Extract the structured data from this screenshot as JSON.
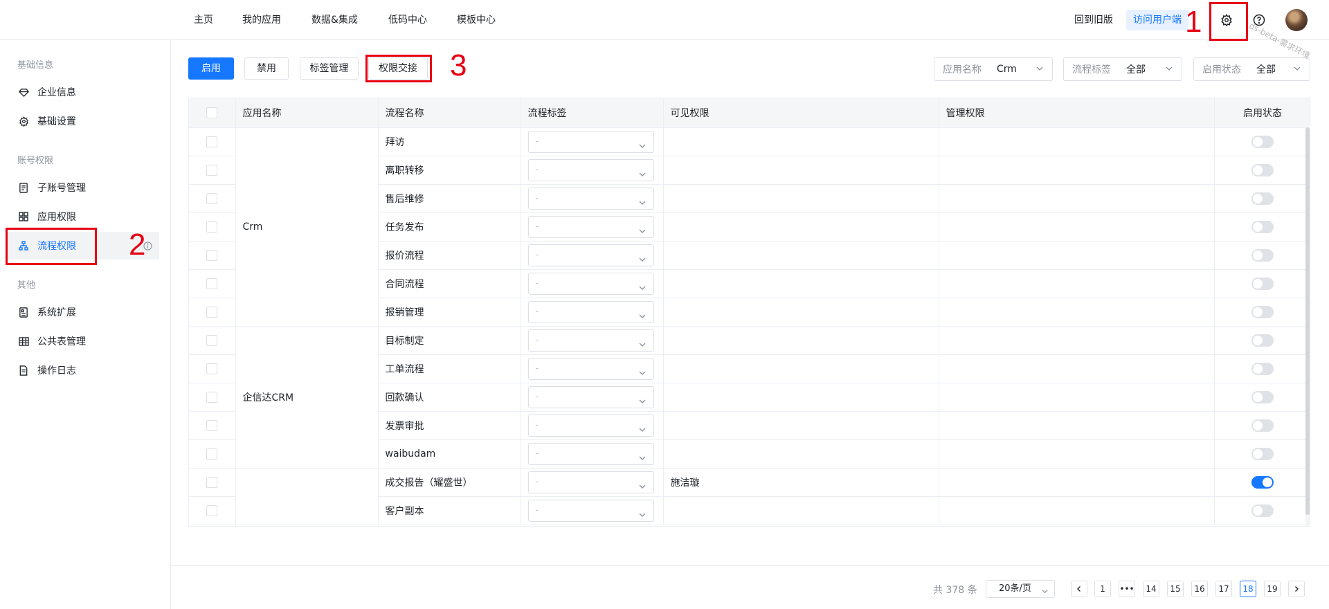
{
  "header": {
    "nav": [
      "主页",
      "我的应用",
      "数据&集成",
      "低码中心",
      "模板中心"
    ],
    "back_old": "回到旧版",
    "visit_user": "访问用户端",
    "watermark": "ds-beta-需求环境"
  },
  "annotations": [
    "1",
    "2",
    "3"
  ],
  "sidebar": {
    "groups": [
      {
        "title": "基础信息",
        "items": [
          {
            "label": "企业信息",
            "icon": "diamond-icon"
          },
          {
            "label": "基础设置",
            "icon": "gear-icon"
          }
        ]
      },
      {
        "title": "账号权限",
        "items": [
          {
            "label": "子账号管理",
            "icon": "document-icon"
          },
          {
            "label": "应用权限",
            "icon": "grid-icon"
          },
          {
            "label": "流程权限",
            "icon": "org-chart-icon",
            "active": true
          }
        ]
      },
      {
        "title": "其他",
        "items": [
          {
            "label": "系统扩展",
            "icon": "extension-icon"
          },
          {
            "label": "公共表管理",
            "icon": "table-icon"
          },
          {
            "label": "操作日志",
            "icon": "log-icon"
          }
        ]
      }
    ]
  },
  "toolbar": {
    "enable": "启用",
    "disable": "禁用",
    "tag_manage": "标签管理",
    "perm_handover": "权限交接"
  },
  "filters": {
    "app_name": {
      "label": "应用名称",
      "value": "Crm"
    },
    "flow_tag": {
      "label": "流程标签",
      "value": "全部"
    },
    "status": {
      "label": "启用状态",
      "value": "全部"
    }
  },
  "table": {
    "columns": [
      "应用名称",
      "流程名称",
      "流程标签",
      "可见权限",
      "管理权限",
      "启用状态"
    ],
    "tag_placeholder": "-",
    "groups": [
      {
        "app": "Crm",
        "rows": [
          {
            "flow": "拜访",
            "visible": "",
            "manage": "",
            "enabled": false
          },
          {
            "flow": "离职转移",
            "visible": "",
            "manage": "",
            "enabled": false
          },
          {
            "flow": "售后维修",
            "visible": "",
            "manage": "",
            "enabled": false
          },
          {
            "flow": "任务发布",
            "visible": "",
            "manage": "",
            "enabled": false
          },
          {
            "flow": "报价流程",
            "visible": "",
            "manage": "",
            "enabled": false
          },
          {
            "flow": "合同流程",
            "visible": "",
            "manage": "",
            "enabled": false
          },
          {
            "flow": "报销管理",
            "visible": "",
            "manage": "",
            "enabled": false
          }
        ]
      },
      {
        "app": "企信达CRM",
        "rows": [
          {
            "flow": "目标制定",
            "visible": "",
            "manage": "",
            "enabled": false
          },
          {
            "flow": "工单流程",
            "visible": "",
            "manage": "",
            "enabled": false
          },
          {
            "flow": "回款确认",
            "visible": "",
            "manage": "",
            "enabled": false
          },
          {
            "flow": "发票审批",
            "visible": "",
            "manage": "",
            "enabled": false
          },
          {
            "flow": "waibudam",
            "visible": "",
            "manage": "",
            "enabled": false
          }
        ]
      },
      {
        "app": "",
        "rows": [
          {
            "flow": "成交报告（耀盛世）",
            "visible": "施洁璇",
            "manage": "",
            "enabled": true
          },
          {
            "flow": "客户副本",
            "visible": "",
            "manage": "",
            "enabled": false
          }
        ]
      }
    ]
  },
  "pagination": {
    "total": "共 378 条",
    "page_size": "20条/页",
    "pages": [
      "1",
      "•••",
      "14",
      "15",
      "16",
      "17",
      "18",
      "19"
    ],
    "current": "18"
  },
  "colors": {
    "primary": "#1677ff",
    "annotation_red": "#e60012"
  }
}
